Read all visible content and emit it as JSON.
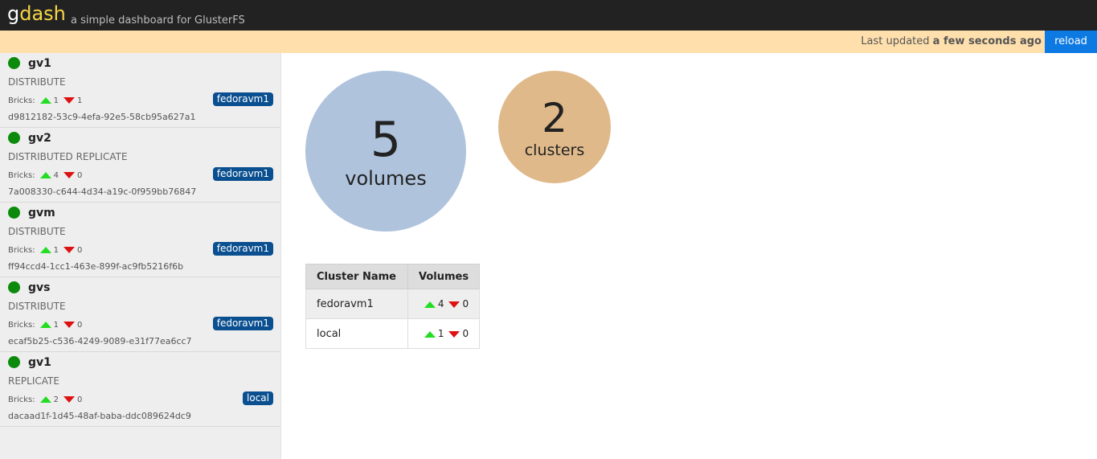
{
  "header": {
    "logo_g": "g",
    "logo_dash": "dash",
    "tagline": "a simple dashboard for GlusterFS"
  },
  "status": {
    "prefix": "Last updated ",
    "time": "a few seconds ago",
    "reload_label": "reload"
  },
  "volumes": [
    {
      "name": "gv1",
      "type": "DISTRIBUTE",
      "bricks_label": "Bricks:",
      "up": "1",
      "down": "1",
      "uuid": "d9812182-53c9-4efa-92e5-58cb95a627a1",
      "cluster": "fedoravm1",
      "status_color": "#0b8a0b"
    },
    {
      "name": "gv2",
      "type": "DISTRIBUTED REPLICATE",
      "bricks_label": "Bricks:",
      "up": "4",
      "down": "0",
      "uuid": "7a008330-c644-4d34-a19c-0f959bb76847",
      "cluster": "fedoravm1",
      "status_color": "#0b8a0b"
    },
    {
      "name": "gvm",
      "type": "DISTRIBUTE",
      "bricks_label": "Bricks:",
      "up": "1",
      "down": "0",
      "uuid": "ff94ccd4-1cc1-463e-899f-ac9fb5216f6b",
      "cluster": "fedoravm1",
      "status_color": "#0b8a0b"
    },
    {
      "name": "gvs",
      "type": "DISTRIBUTE",
      "bricks_label": "Bricks:",
      "up": "1",
      "down": "0",
      "uuid": "ecaf5b25-c536-4249-9089-e31f77ea6cc7",
      "cluster": "fedoravm1",
      "status_color": "#0b8a0b"
    },
    {
      "name": "gv1",
      "type": "REPLICATE",
      "bricks_label": "Bricks:",
      "up": "2",
      "down": "0",
      "uuid": "dacaad1f-1d45-48af-baba-ddc089624dc9",
      "cluster": "local",
      "status_color": "#0b8a0b"
    }
  ],
  "summary": {
    "volumes_count": "5",
    "volumes_label": "volumes",
    "clusters_count": "2",
    "clusters_label": "clusters"
  },
  "clusters_table": {
    "headers": [
      "Cluster Name",
      "Volumes"
    ],
    "rows": [
      {
        "name": "fedoravm1",
        "up": "4",
        "down": "0"
      },
      {
        "name": "local",
        "up": "1",
        "down": "0"
      }
    ]
  },
  "colors": {
    "header_bg": "#222222",
    "status_bg": "#ffe0ad",
    "reload_bg": "#0d7ae4",
    "volumes_circle": "#afc3dd",
    "clusters_circle": "#dfb98a",
    "badge_bg": "#0a4f8f",
    "up_arrow": "#22dd22",
    "down_arrow": "#dd1111"
  },
  "icons": {
    "status": "status-dot-icon",
    "up": "arrow-up-icon",
    "down": "arrow-down-icon"
  }
}
